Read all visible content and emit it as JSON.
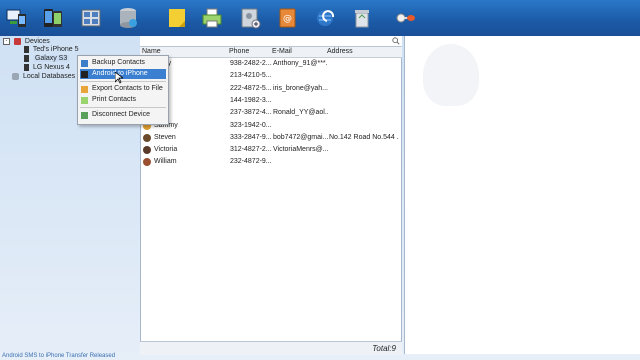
{
  "colors": {
    "toolbar": "#1b5aa6",
    "menu_highlight": "#3b7fd1",
    "status_link": "#3a6fb0"
  },
  "toolbar": {
    "buttons": [
      {
        "name": "devices-button",
        "icon": "devices-icon"
      },
      {
        "name": "phones-button",
        "icon": "phones-icon"
      },
      {
        "name": "transfer-button",
        "icon": "transfer-icon"
      },
      {
        "name": "database-button",
        "icon": "database-icon"
      },
      {
        "name": "notes-button",
        "icon": "notes-icon"
      },
      {
        "name": "print-button",
        "icon": "printer-icon"
      },
      {
        "name": "add-contact-button",
        "icon": "add-contact-icon"
      },
      {
        "name": "email-button",
        "icon": "email-contact-icon"
      },
      {
        "name": "sync-button",
        "icon": "globe-sync-icon"
      },
      {
        "name": "recycle-button",
        "icon": "recycle-bin-icon"
      },
      {
        "name": "register-button",
        "icon": "key-icon"
      }
    ]
  },
  "tree": {
    "devices_label": "Devices",
    "items": [
      {
        "label": "Ted's iPhone 5"
      },
      {
        "label": "Galaxy S3"
      },
      {
        "label": "LG Nexus 4"
      }
    ],
    "local_db_label": "Local Databases"
  },
  "context_menu": {
    "items": [
      {
        "label": "Backup Contacts",
        "icon": "backup-icon"
      },
      {
        "label": "Android to iPhone",
        "icon": "phone-transfer-icon"
      },
      {
        "label": "Export Contacts to File",
        "icon": "export-icon"
      },
      {
        "label": "Print Contacts",
        "icon": "print-icon"
      },
      {
        "label": "Disconnect Device",
        "icon": "disconnect-icon"
      }
    ]
  },
  "list": {
    "columns": {
      "name": "Name",
      "phone": "Phone",
      "email": "E-Mail",
      "address": "Address"
    },
    "rows": [
      {
        "name": "...ony",
        "phone": "938-2482-2...",
        "email": "Anthony_91@***...",
        "address": ""
      },
      {
        "name": "...e",
        "phone": "213-4210-5...",
        "email": "",
        "address": ""
      },
      {
        "name": "",
        "phone": "222-4872-5...",
        "email": "iris_brone@yah...",
        "address": ""
      },
      {
        "name": "...in",
        "phone": "144-1982-3...",
        "email": "",
        "address": ""
      },
      {
        "name": "...ld",
        "phone": "237-3872-4...",
        "email": "Ronald_YY@aol...",
        "address": ""
      },
      {
        "name": "Sammy",
        "phone": "323-1942-0...",
        "email": "",
        "address": ""
      },
      {
        "name": "Steven",
        "phone": "333-2847-9...",
        "email": "bob7472@gmai...",
        "address": "No.142 Road No.544 ..."
      },
      {
        "name": "Victoria",
        "phone": "312-4827-2...",
        "email": "VictoriaMenrs@...",
        "address": ""
      },
      {
        "name": "William",
        "phone": "232-4872-9...",
        "email": "",
        "address": ""
      }
    ],
    "total": "Total:9"
  },
  "status_text": "Android SMS to iPhone Transfer Released"
}
